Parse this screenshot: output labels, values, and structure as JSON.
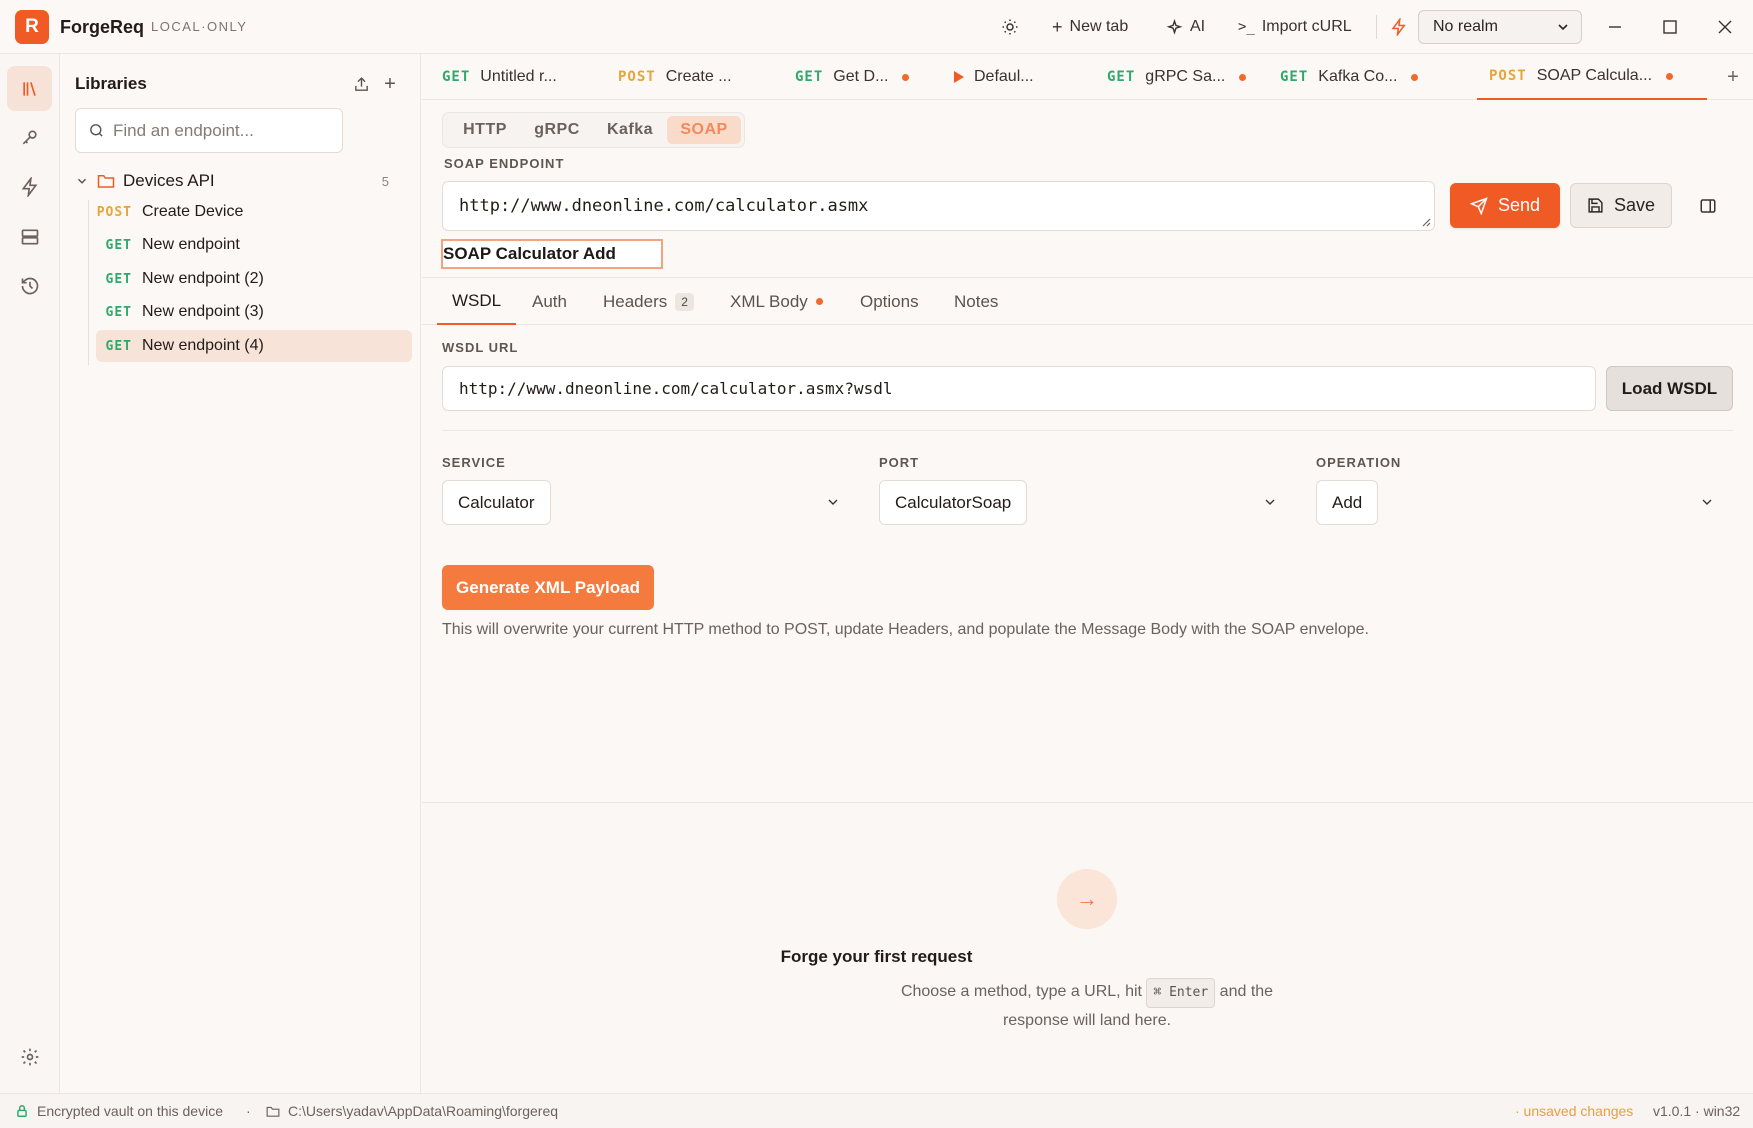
{
  "app": {
    "logo_letter": "R",
    "name": "ForgeReq",
    "mode": "LOCAL·ONLY"
  },
  "toolbar": {
    "new_tab": "New tab",
    "ai": "AI",
    "import_curl": "Import cURL",
    "realm": "No realm"
  },
  "sidebar": {
    "title": "Libraries",
    "search_placeholder": "Find an endpoint...",
    "folder": {
      "name": "Devices API",
      "count": "5"
    },
    "endpoints": [
      {
        "method": "POST",
        "name": "Create Device"
      },
      {
        "method": "GET",
        "name": "New endpoint"
      },
      {
        "method": "GET",
        "name": "New endpoint (2)"
      },
      {
        "method": "GET",
        "name": "New endpoint (3)"
      },
      {
        "method": "GET",
        "name": "New endpoint (4)"
      }
    ]
  },
  "tabs": [
    {
      "method": "GET",
      "label": "Untitled r..."
    },
    {
      "method": "POST",
      "label": "Create ..."
    },
    {
      "method": "GET",
      "label": "Get D..."
    },
    {
      "method": "",
      "label": "Defaul..."
    },
    {
      "method": "GET",
      "label": "gRPC Sa..."
    },
    {
      "method": "GET",
      "label": "Kafka Co..."
    },
    {
      "method": "POST",
      "label": "SOAP Calcula..."
    }
  ],
  "protocols": [
    "HTTP",
    "gRPC",
    "Kafka",
    "SOAP"
  ],
  "request": {
    "endpoint_label": "SOAP ENDPOINT",
    "endpoint_url": "http://www.dneonline.com/calculator.asmx",
    "send": "Send",
    "save": "Save",
    "name": "SOAP Calculator Add"
  },
  "subtabs": {
    "wsdl": "WSDL",
    "auth": "Auth",
    "headers": "Headers",
    "headers_count": "2",
    "xml_body": "XML Body",
    "options": "Options",
    "notes": "Notes"
  },
  "wsdl": {
    "url_label": "WSDL URL",
    "url": "http://www.dneonline.com/calculator.asmx?wsdl",
    "load_button": "Load WSDL",
    "service_label": "SERVICE",
    "service": "Calculator",
    "port_label": "PORT",
    "port": "CalculatorSoap",
    "operation_label": "OPERATION",
    "operation": "Add",
    "generate_button": "Generate XML Payload",
    "note": "This will overwrite your current HTTP method to POST, update Headers, and populate the Message Body with the SOAP envelope."
  },
  "response": {
    "arrow": "→",
    "title": "Forge your first request",
    "sub_before": "Choose a method, type a URL, hit",
    "kbd": "⌘ Enter",
    "sub_after": "and the response will land here."
  },
  "status": {
    "vault": "Encrypted vault on this device",
    "path": "C:\\Users\\yadav\\AppData\\Roaming\\forgereq",
    "unsaved": "· unsaved changes",
    "version": "v1.0.1 · win32"
  },
  "colors": {
    "accent": "#f05a24",
    "get": "#2fa86b",
    "post": "#e8a33a"
  }
}
